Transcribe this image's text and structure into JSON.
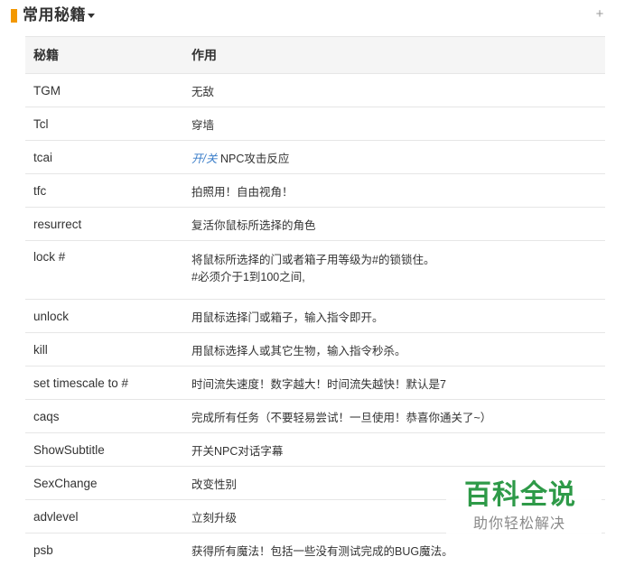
{
  "section": {
    "title": "常用秘籍"
  },
  "table": {
    "headers": {
      "code": "秘籍",
      "effect": "作用"
    },
    "rows": [
      {
        "code": "TGM",
        "effect": "无敌"
      },
      {
        "code": "Tcl",
        "effect": "穿墙"
      },
      {
        "code": "tcai",
        "effect_link": "开/关",
        "effect": " NPC攻击反应"
      },
      {
        "code": "tfc",
        "effect": "拍照用！自由视角！"
      },
      {
        "code": "resurrect",
        "effect": "复活你鼠标所选择的角色"
      },
      {
        "code": "lock #",
        "effect": "将鼠标所选择的门或者箱子用等级为#的锁锁住。",
        "effect_line2": "#必须介于1到100之间,"
      },
      {
        "code": "unlock",
        "effect": "用鼠标选择门或箱子，输入指令即开。"
      },
      {
        "code": "kill",
        "effect": "用鼠标选择人或其它生物，输入指令秒杀。"
      },
      {
        "code": "set timescale to #",
        "effect": "时间流失速度！数字越大！时间流失越快！默认是7"
      },
      {
        "code": "caqs",
        "effect": "完成所有任务（不要轻易尝试！一旦使用！恭喜你通关了~）"
      },
      {
        "code": "ShowSubtitle",
        "effect": "开关NPC对话字幕"
      },
      {
        "code": "SexChange",
        "effect": "改变性别"
      },
      {
        "code": "advlevel",
        "effect": "立刻升级"
      },
      {
        "code": "psb",
        "effect": "获得所有魔法！包括一些没有测试完成的BUG魔法。"
      }
    ]
  },
  "watermark": {
    "title": "百科全说",
    "subtitle": "助你轻松解决"
  },
  "colors": {
    "accent": "#f39800",
    "link": "#3a7dc9",
    "watermark_green": "#2e9a48",
    "header_bg": "#f5f5f5",
    "border": "#e6e6e6"
  },
  "icons": {
    "caret": "caret-down-icon",
    "expand": "plus-icon"
  }
}
